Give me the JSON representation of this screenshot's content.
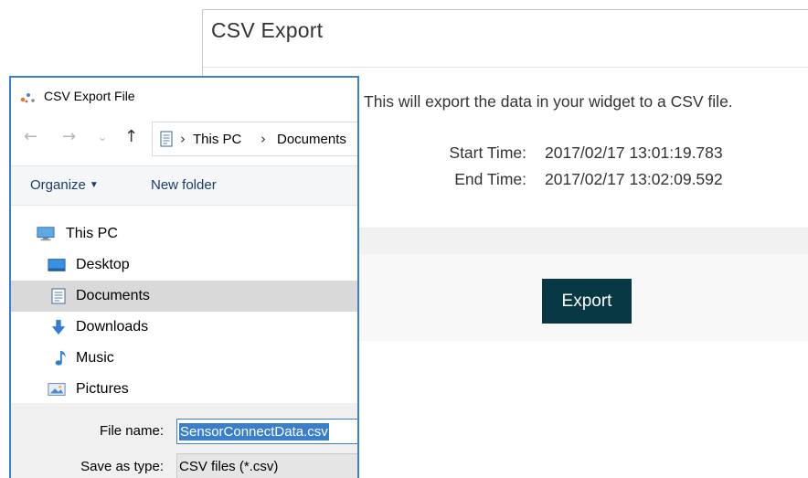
{
  "csv_export": {
    "title": "CSV Export",
    "message": "This will export the data in your widget to a CSV file.",
    "start_label": "Start Time:",
    "start_value": "2017/02/17 13:01:19.783",
    "end_label": "End Time:",
    "end_value": "2017/02/17 13:02:09.592",
    "export_label": "Export",
    "button_color": "#073844"
  },
  "file_dialog": {
    "title": "CSV Export File",
    "address": {
      "segments": [
        "This PC",
        "Documents"
      ],
      "separator": "›"
    },
    "nav_icons": [
      "back-arrow-icon",
      "forward-arrow-icon",
      "recent-dropdown-icon",
      "up-arrow-icon"
    ],
    "toolbar": {
      "organize_label": "Organize",
      "new_folder_label": "New folder"
    },
    "tree": [
      {
        "label": "This PC",
        "icon": "monitor-icon",
        "selected": false
      },
      {
        "label": "Desktop",
        "icon": "desktop-icon",
        "selected": false
      },
      {
        "label": "Documents",
        "icon": "document-icon",
        "selected": true
      },
      {
        "label": "Downloads",
        "icon": "download-arrow-icon",
        "selected": false
      },
      {
        "label": "Music",
        "icon": "music-note-icon",
        "selected": false
      },
      {
        "label": "Pictures",
        "icon": "pictures-icon",
        "selected": false
      }
    ],
    "file_name_label": "File name:",
    "file_name_value": "SensorConnectData.csv",
    "save_as_type_label": "Save as type:",
    "save_as_type_value": "CSV files (*.csv)",
    "accent_color": "#3d7ecf"
  }
}
